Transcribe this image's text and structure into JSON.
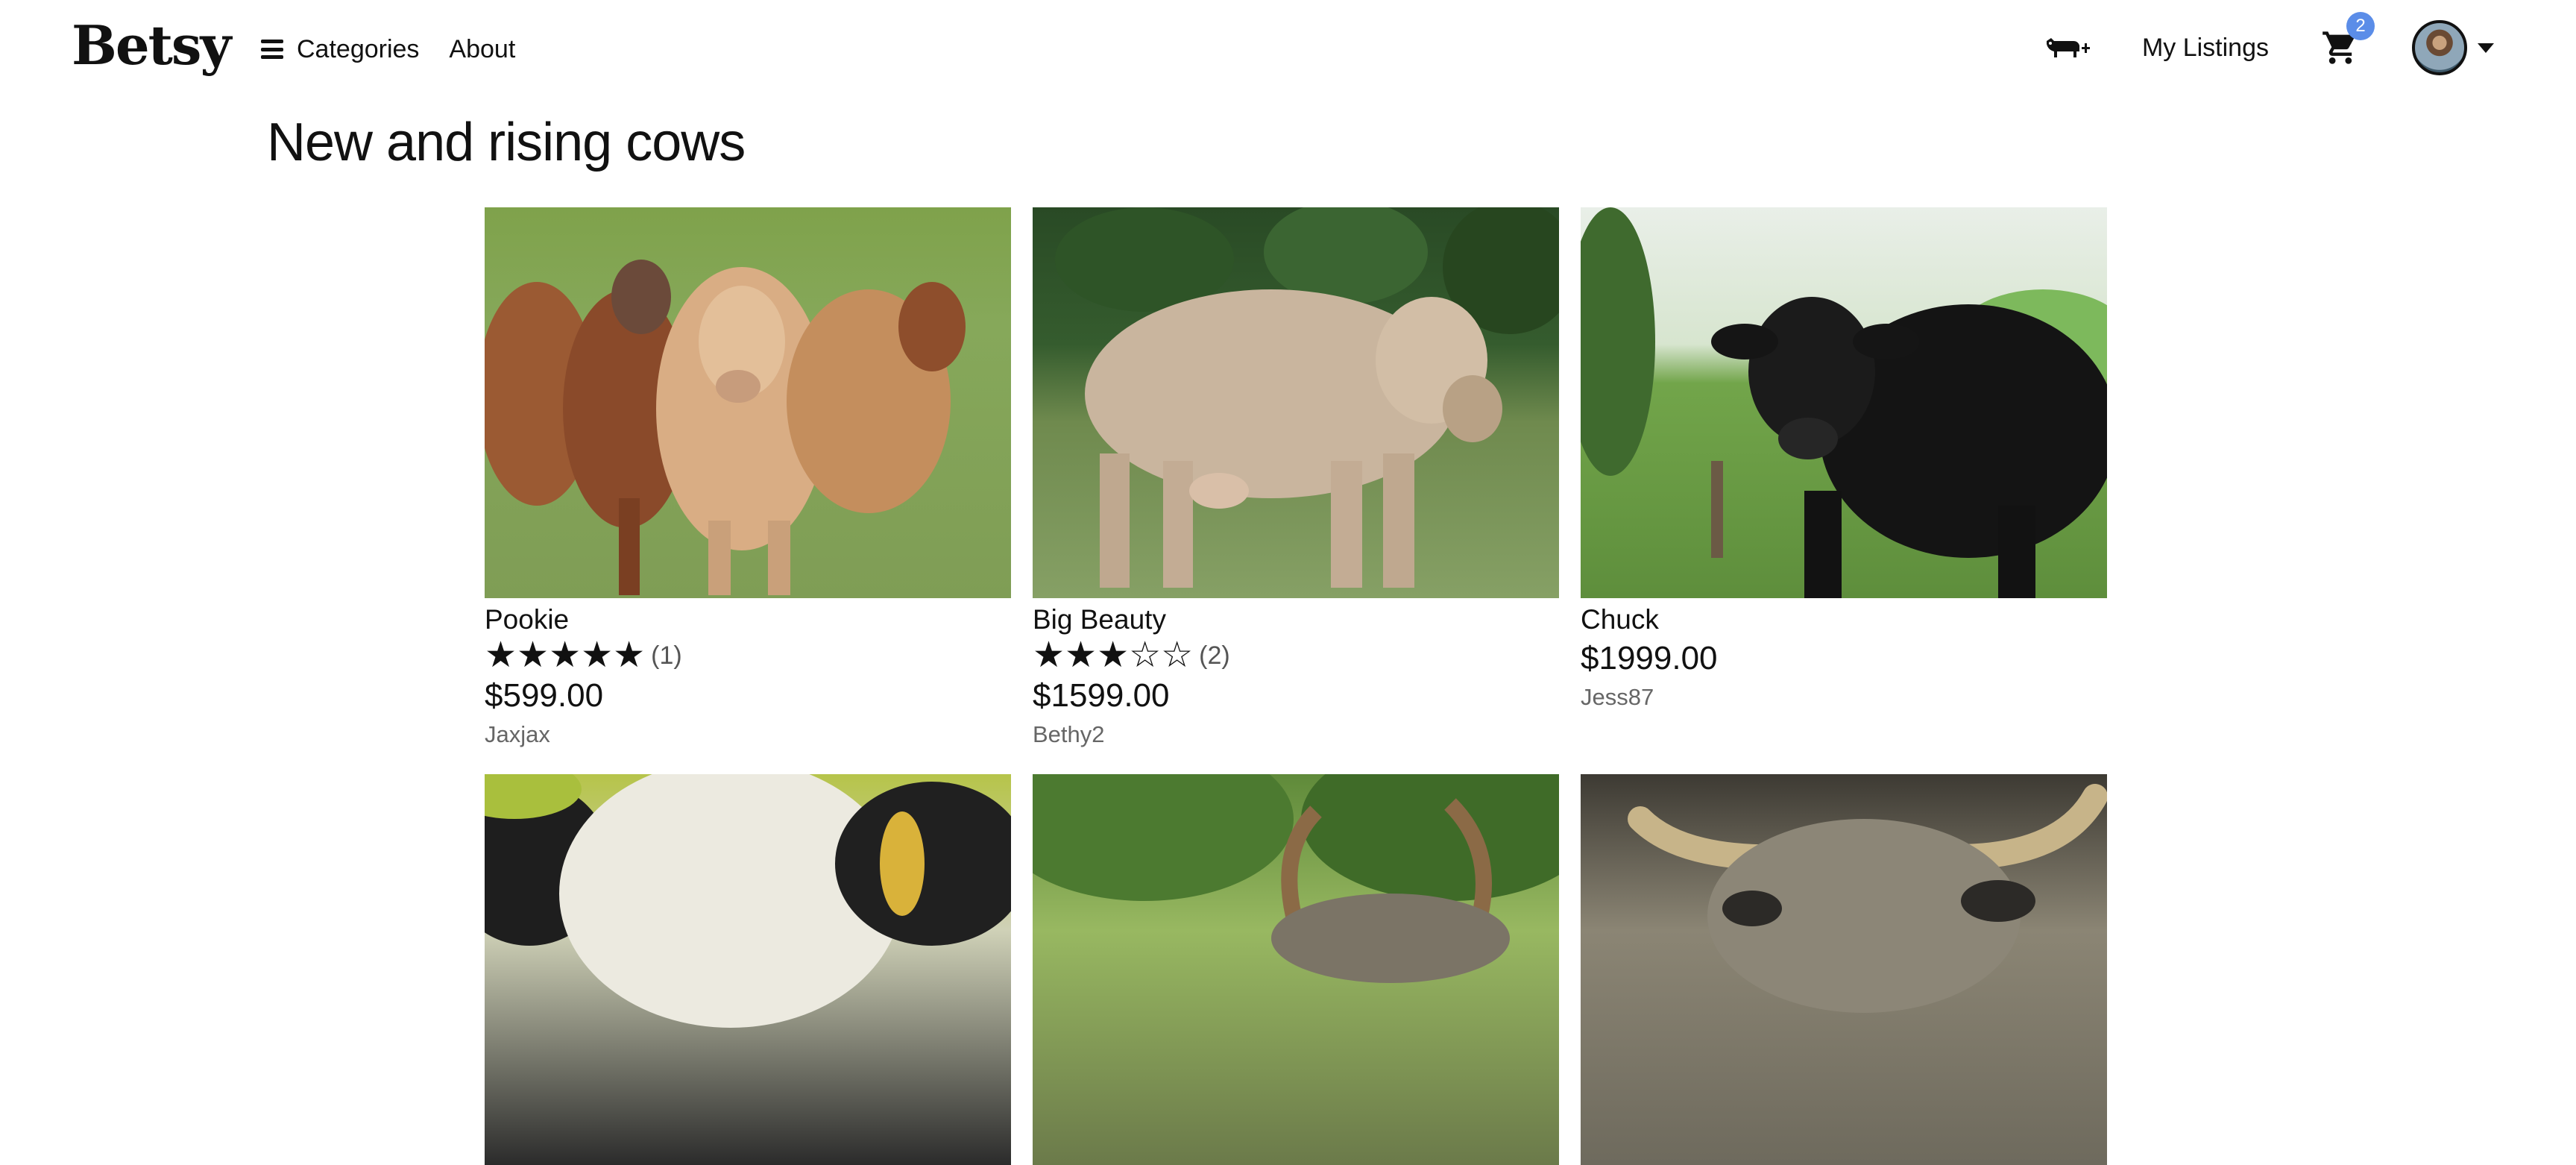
{
  "header": {
    "logo": "Betsy",
    "categories_label": "Categories",
    "about_label": "About",
    "add_cow_icon": "cow-plus-icon",
    "my_listings_label": "My Listings",
    "cart_icon": "cart-icon",
    "cart_count": "2",
    "avatar_icon": "user-avatar",
    "dropdown_icon": "caret-down-icon"
  },
  "main": {
    "title": "New and rising cows",
    "listings": [
      {
        "name": "Pookie",
        "stars_filled": 5,
        "stars_total": 5,
        "stars_text": "★★★★★",
        "review_count": "(1)",
        "price": "$599.00",
        "seller": "Jaxjax"
      },
      {
        "name": "Big Beauty",
        "stars_filled": 3,
        "stars_total": 5,
        "stars_text": "★★★☆☆",
        "review_count": "(2)",
        "price": "$1599.00",
        "seller": "Bethy2"
      },
      {
        "name": "Chuck",
        "price": "$1999.00",
        "seller": "Jess87"
      }
    ]
  },
  "colors": {
    "accent_badge": "#5b8de8",
    "text": "#111111",
    "muted": "#666666"
  }
}
